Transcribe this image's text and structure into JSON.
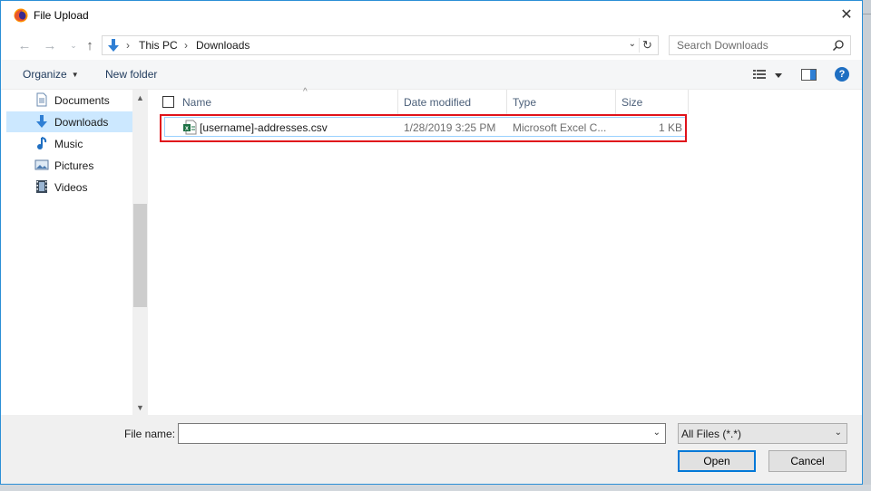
{
  "window": {
    "title": "File Upload",
    "close_label": "✕"
  },
  "nav": {
    "breadcrumbs": [
      "This PC",
      "Downloads"
    ],
    "separator": "›",
    "search_placeholder": "Search Downloads"
  },
  "toolbar": {
    "organize_label": "Organize",
    "new_folder_label": "New folder",
    "help_label": "?"
  },
  "sidebar": {
    "items": [
      {
        "label": "Documents",
        "icon": "documents-icon"
      },
      {
        "label": "Downloads",
        "icon": "downloads-icon",
        "selected": true
      },
      {
        "label": "Music",
        "icon": "music-icon"
      },
      {
        "label": "Pictures",
        "icon": "pictures-icon"
      },
      {
        "label": "Videos",
        "icon": "videos-icon"
      }
    ]
  },
  "columns": [
    "Name",
    "Date modified",
    "Type",
    "Size"
  ],
  "files": [
    {
      "name": "[username]-addresses.csv",
      "date": "1/28/2019 3:25 PM",
      "type": "Microsoft Excel C...",
      "size": "1 KB",
      "icon": "excel-csv-icon"
    }
  ],
  "bottom": {
    "file_name_label": "File name:",
    "file_name_value": "",
    "filter": "All Files (*.*)",
    "open_label": "Open",
    "cancel_label": "Cancel"
  },
  "colors": {
    "accent": "#0078d7",
    "highlight": "#e0131b",
    "selection": "#cce8ff"
  }
}
